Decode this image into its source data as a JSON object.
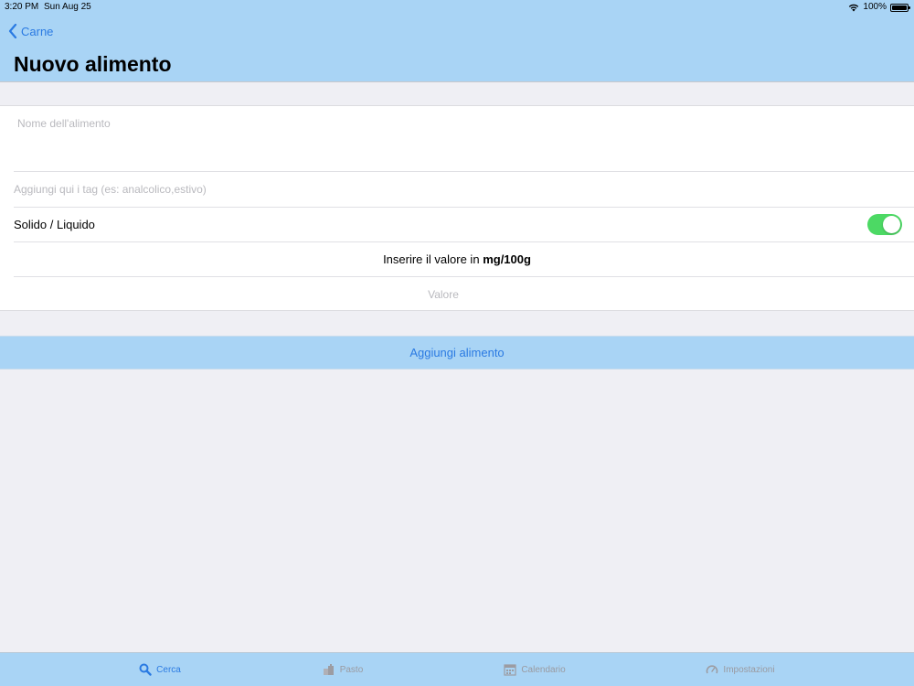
{
  "status_bar": {
    "time": "3:20 PM",
    "date": "Sun Aug 25",
    "battery": "100%"
  },
  "nav": {
    "back_label": "Carne",
    "title": "Nuovo alimento"
  },
  "form": {
    "name_placeholder": "Nome dell'alimento",
    "tags_placeholder": "Aggiungi qui i tag (es: analcolico,estivo)",
    "solid_liquid_label": "Solido / Liquido",
    "solid_liquid_on": true,
    "unit_prefix": "Inserire il valore in",
    "unit": "mg/100g",
    "value_placeholder": "Valore"
  },
  "add_button_label": "Aggiungi alimento",
  "tabs": [
    {
      "label": "Cerca",
      "icon": "search-icon",
      "active": true
    },
    {
      "label": "Pasto",
      "icon": "meal-icon",
      "active": false
    },
    {
      "label": "Calendario",
      "icon": "calendar-icon",
      "active": false
    },
    {
      "label": "Impostazioni",
      "icon": "gauge-icon",
      "active": false
    }
  ],
  "colors": {
    "bar_background": "#a9d4f5",
    "accent": "#2a7ae2",
    "toggle_on": "#4cd964",
    "page_background": "#efeff4"
  }
}
